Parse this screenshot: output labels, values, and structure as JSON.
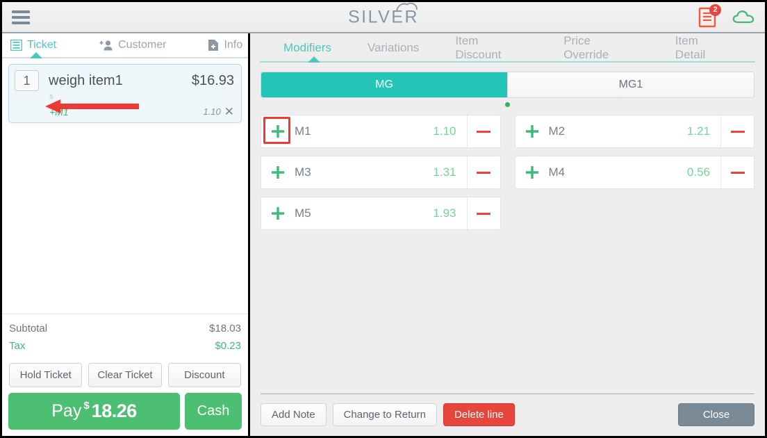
{
  "header": {
    "menu_icon": "hamburger-icon",
    "logo_text": "SILVER",
    "logo_cloud_icon": "cloud-icon",
    "receipt_icon": "receipt-icon",
    "receipt_badge": "2",
    "cloud_status_icon": "cloud-icon",
    "accent_color": "#4bc8bc",
    "badge_color": "#e8453c"
  },
  "left_panel": {
    "tabs": [
      {
        "label": "Ticket",
        "icon": "list-icon",
        "active": true
      },
      {
        "label": "Customer",
        "icon": "add-person-icon",
        "active": false
      },
      {
        "label": "Info",
        "icon": "document-plus-icon",
        "active": false
      }
    ],
    "ticket_item": {
      "qty": "1",
      "name": "weigh item1",
      "price": "$16.93",
      "sub_label": "s",
      "modifier_name": "+M1",
      "modifier_price": "1.10",
      "remove_icon": "close-icon"
    },
    "totals": [
      {
        "label": "Subtotal",
        "value": "$18.03",
        "green": false
      },
      {
        "label": "Tax",
        "value": "$0.23",
        "green": true
      }
    ],
    "buttons": [
      {
        "label": "Hold Ticket"
      },
      {
        "label": "Clear Ticket"
      },
      {
        "label": "Discount"
      }
    ],
    "pay": {
      "label": "Pay",
      "dollar": "$",
      "amount": "18.26",
      "cash_label": "Cash",
      "color": "#4cbf72"
    }
  },
  "right_panel": {
    "tabs": [
      {
        "label": "Modifiers",
        "active": true
      },
      {
        "label": "Variations",
        "active": false
      },
      {
        "label": "Item Discount",
        "active": false
      },
      {
        "label": "Price Override",
        "active": false
      },
      {
        "label": "Item Detail",
        "active": false
      }
    ],
    "modifier_groups": [
      {
        "label": "MG",
        "active": true
      },
      {
        "label": "MG1",
        "active": false
      }
    ],
    "page_indicator": {
      "count": 1,
      "current": 0,
      "color": "#34ae5f"
    },
    "modifiers": [
      {
        "name": "M1",
        "price": "1.10",
        "add_icon": "plus-icon",
        "remove_icon": "minus-icon",
        "highlighted": true
      },
      {
        "name": "M2",
        "price": "1.21",
        "add_icon": "plus-icon",
        "remove_icon": "minus-icon",
        "highlighted": false
      },
      {
        "name": "M3",
        "price": "1.31",
        "add_icon": "plus-icon",
        "remove_icon": "minus-icon",
        "highlighted": false
      },
      {
        "name": "M4",
        "price": "0.56",
        "add_icon": "plus-icon",
        "remove_icon": "minus-icon",
        "highlighted": false
      },
      {
        "name": "M5",
        "price": "1.93",
        "add_icon": "plus-icon",
        "remove_icon": "minus-icon",
        "highlighted": false
      }
    ],
    "footer_buttons": [
      {
        "label": "Add Note",
        "style": "default"
      },
      {
        "label": "Change to Return",
        "style": "default"
      },
      {
        "label": "Delete line",
        "style": "danger"
      },
      {
        "label": "Close",
        "style": "close"
      }
    ]
  },
  "annotations": {
    "arrow_color": "#ec3a34",
    "highlight_color": "#ec3a34"
  }
}
